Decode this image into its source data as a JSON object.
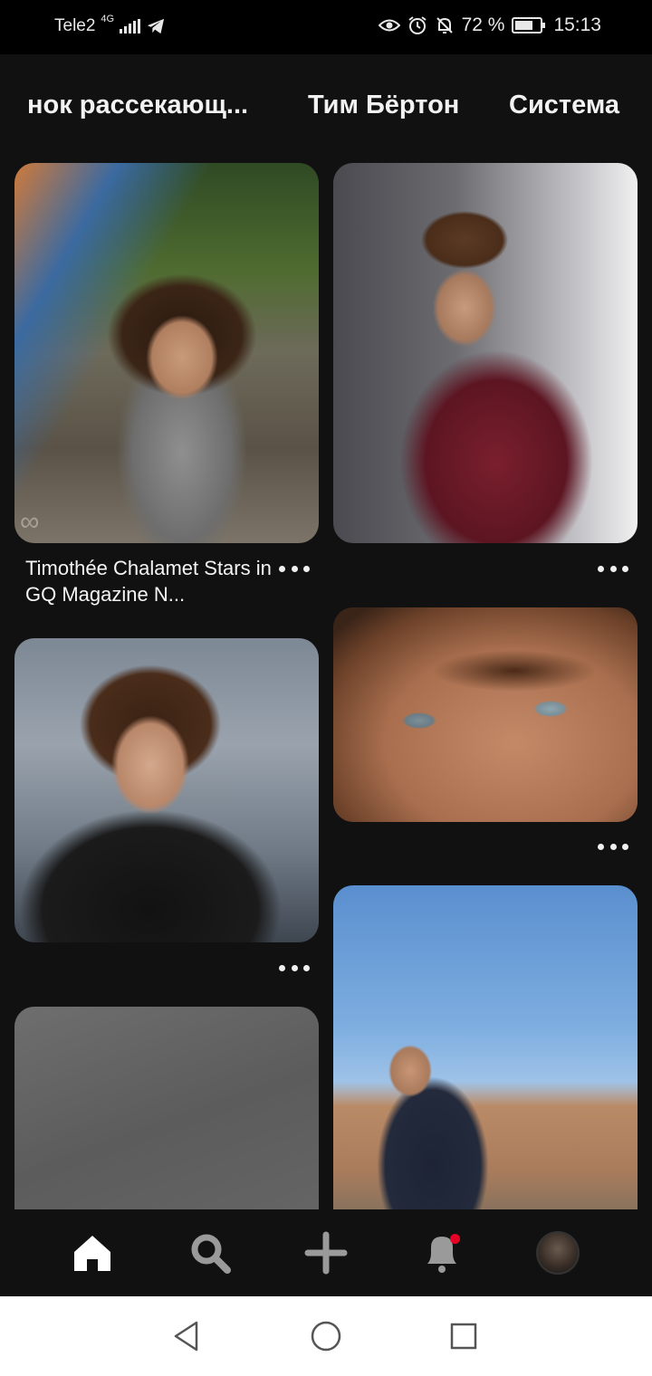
{
  "status_bar": {
    "carrier": "Tele2",
    "network": "4G",
    "battery": "72 %",
    "battery_level": 0.72,
    "time": "15:13"
  },
  "topics": [
    "нок рассекающ...",
    "Тим Бёртон",
    "Система"
  ],
  "pins": [
    {
      "title": "Timothée Chalamet Stars in GQ Magazine N..."
    }
  ],
  "bottom_nav": {
    "items": [
      "home-icon",
      "search-icon",
      "add-icon",
      "notifications-icon",
      "profile-avatar"
    ],
    "active": "home",
    "notification_dot_color": "#e60023"
  },
  "system_nav": [
    "back",
    "home",
    "recents"
  ]
}
